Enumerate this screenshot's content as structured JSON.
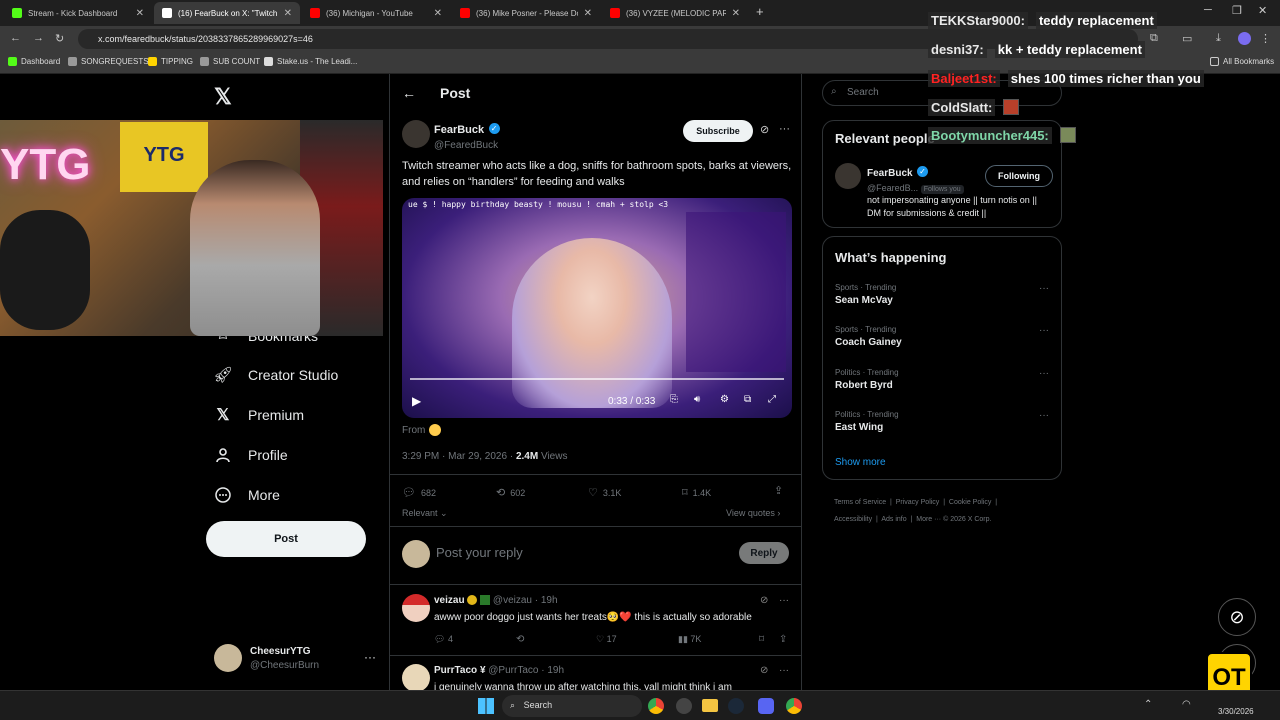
{
  "browser": {
    "tabs": [
      {
        "title": "Stream - Kick Dashboard",
        "fav_color": "#53fc18",
        "active": false
      },
      {
        "title": "(16) FearBuck on X: \"Twitch streamer",
        "fav_color": "#ffffff",
        "active": true
      },
      {
        "title": "(36) Michigan - YouTube",
        "fav_color": "#ff0000",
        "active": false
      },
      {
        "title": "(36) Mike Posner - Please Don't",
        "fav_color": "#ff0000",
        "active": false
      },
      {
        "title": "(36) VYZEE (MELODIC PART) - Y",
        "fav_color": "#ff0000",
        "active": false
      }
    ],
    "url": "x.com/fearedbuck/status/2038337865289969027s=46",
    "bookmarks": [
      {
        "label": "Dashboard",
        "color": "#53fc18"
      },
      {
        "label": "SONGREQUESTS",
        "color": "#999999"
      },
      {
        "label": "TIPPING",
        "color": "#ffd400"
      },
      {
        "label": "SUB COUNT",
        "color": "#999999"
      },
      {
        "label": "Stake.us - The Leadi...",
        "color": "#dddddd"
      }
    ],
    "all_bookmarks": "All Bookmarks"
  },
  "left_nav": {
    "items": [
      {
        "label": "Bookmarks",
        "icon": "bookmark-icon"
      },
      {
        "label": "Creator Studio",
        "icon": "rocket-icon"
      },
      {
        "label": "Premium",
        "icon": "x-logo-icon"
      },
      {
        "label": "Profile",
        "icon": "profile-icon"
      },
      {
        "label": "More",
        "icon": "more-circle-icon"
      }
    ],
    "post_label": "Post",
    "account": {
      "name": "CheesurYTG",
      "handle": "@CheesurBurn"
    }
  },
  "webcam": {
    "sign_text_1": "YTG",
    "sign_text_2": "YTG"
  },
  "post": {
    "header": "Post",
    "author_name": "FearBuck",
    "author_handle": "@FearedBuck",
    "subscribe_label": "Subscribe",
    "text": "Twitch streamer who acts like a dog, sniffs for bathroom spots, barks at viewers, and relies on “handlers” for feeding and walks",
    "video_overlay_text": "ue $ ! happy birthday beasty ! mousu ! cmah + stolp <3",
    "video_time": "0:33 / 0:33",
    "from_label": "From",
    "timestamp": "3:29 PM · Mar 29, 2026 ·",
    "views_count": "2.4M",
    "views_label": "Views",
    "replies": "682",
    "reposts": "602",
    "likes": "3.1K",
    "bookmarks": "1.4K",
    "sort_label": "Relevant",
    "view_quotes": "View quotes",
    "reply_placeholder": "Post your reply",
    "reply_button": "Reply"
  },
  "replies": [
    {
      "name": "veizau",
      "handle": "@veizau",
      "time": "· 19h",
      "text": "awww poor doggo just wants her treats🥺❤️ this is actually so adorable",
      "replies": "4",
      "likes": "17",
      "views": "7K"
    },
    {
      "name": "PurrTaco ¥",
      "handle": "@PurrTaco",
      "time": "· 19h",
      "text": "i genuinely wanna throw up after watching this. yall might think i am"
    }
  ],
  "right": {
    "search_placeholder": "Search",
    "relevant_title": "Relevant people",
    "relevant_person": {
      "name": "FearBuck",
      "handle": "@FearedB...",
      "follows_you": "Follows you",
      "button": "Following",
      "bio": "not impersonating anyone || turn notis on || DM for submissions & credit ||"
    },
    "happening_title": "What’s happening",
    "trends": [
      {
        "category": "Sports · Trending",
        "name": "Sean McVay"
      },
      {
        "category": "Sports · Trending",
        "name": "Coach Gainey"
      },
      {
        "category": "Politics · Trending",
        "name": "Robert Byrd"
      },
      {
        "category": "Politics · Trending",
        "name": "East Wing"
      }
    ],
    "show_more": "Show more",
    "footer": [
      "Terms of Service",
      "Privacy Policy",
      "Cookie Policy",
      "Accessibility",
      "Ads info",
      "More ···",
      "© 2026 X Corp."
    ]
  },
  "chat": [
    {
      "user": "TEKKStar9000:",
      "message": "teddy replacement",
      "color": "#e8e8e8"
    },
    {
      "user": "desni37:",
      "message": "kk + teddy replacement",
      "color": "#e8e8e8"
    },
    {
      "user": "Baljeet1st:",
      "message": "shes 100 times richer than you",
      "color": "#ff2222"
    },
    {
      "user": "ColdSlatt:",
      "message": "",
      "color": "#e8e8e8"
    },
    {
      "user": "Bootymuncher445:",
      "message": "",
      "color": "#7fd6a8"
    }
  ],
  "taskbar": {
    "search_label": "Search",
    "date": "3/30/2026"
  }
}
